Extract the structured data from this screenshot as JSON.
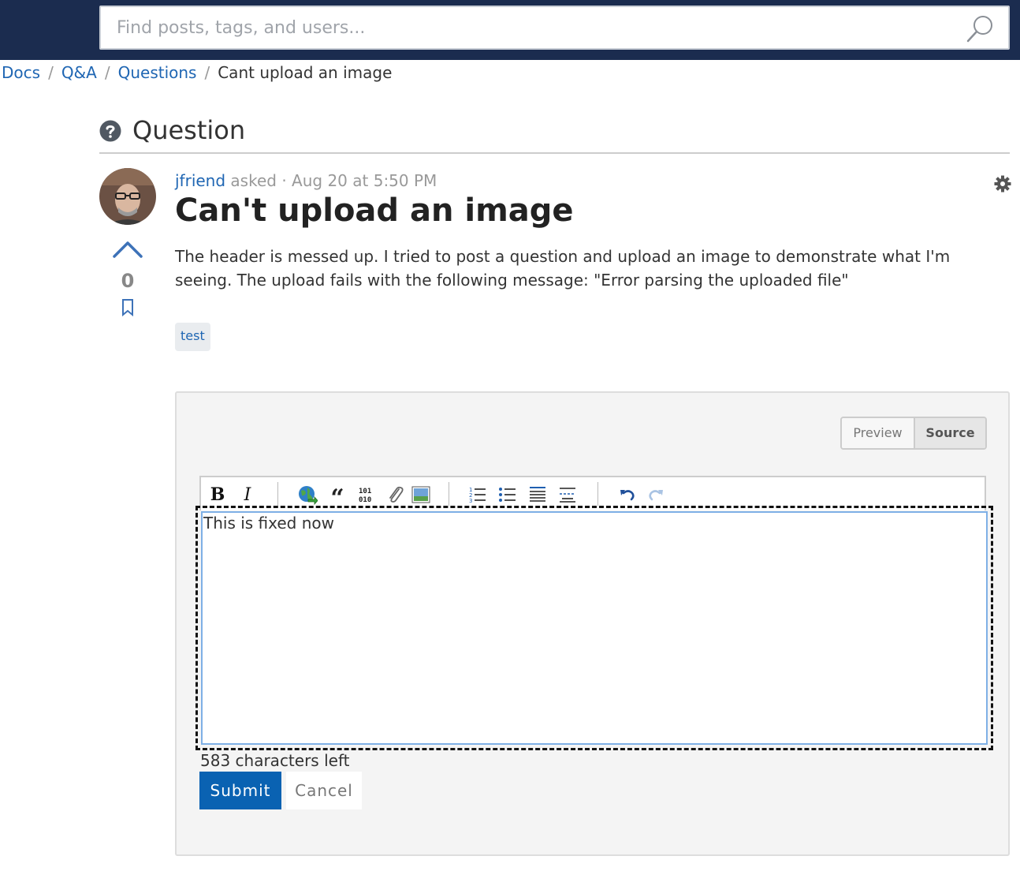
{
  "search": {
    "placeholder": "Find posts, tags, and users..."
  },
  "breadcrumb": {
    "items": [
      "Docs",
      "Q&A",
      "Questions"
    ],
    "current": "Cant upload an image",
    "separator": "/"
  },
  "section": {
    "title": "Question",
    "icon": "question-circle-icon"
  },
  "post": {
    "author": "jfriend",
    "asked_label": "asked",
    "dot": "·",
    "date": "Aug 20 at 5:50 PM",
    "title": "Can't upload an image",
    "body": "The header is messed up. I tried to post a question and upload an image to demonstrate what I'm seeing. The upload fails with the following message: \"Error parsing the uploaded file\"",
    "votes": "0",
    "tags": [
      "test"
    ]
  },
  "editor": {
    "tabs": [
      "Preview",
      "Source"
    ],
    "active_tab": "Source",
    "value": "This is fixed now",
    "chars_left": "583 characters left",
    "submit_label": "Submit",
    "cancel_label": "Cancel",
    "toolbar": [
      "bold",
      "italic",
      "link",
      "quote",
      "code",
      "attachment",
      "image",
      "numbered-list",
      "bullet-list",
      "align-left",
      "horizontal-rule",
      "undo",
      "redo"
    ]
  },
  "colors": {
    "header_bg": "#1b2c4f",
    "link": "#1f66b3",
    "primary_button": "#0a62b2"
  }
}
